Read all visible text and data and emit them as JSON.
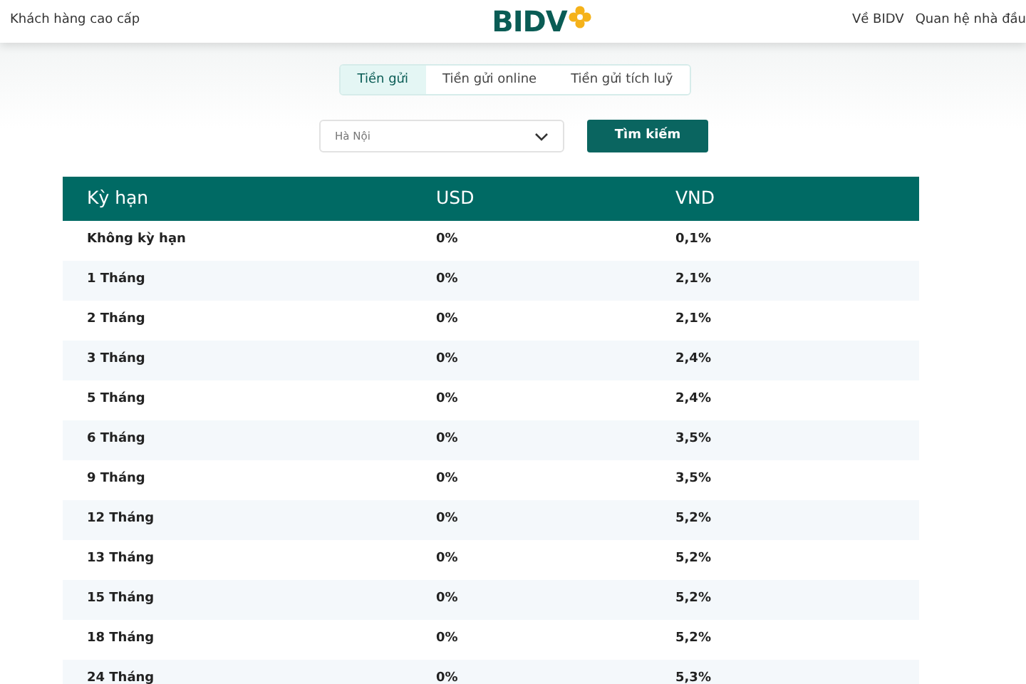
{
  "header": {
    "left_link": "Khách hàng cao cấp",
    "logo": "BIDV",
    "right_links": [
      "Về BIDV",
      "Quan hệ nhà đầu"
    ]
  },
  "tabs": [
    {
      "label": "Tiền gửi",
      "selected": true
    },
    {
      "label": "Tiền gửi online",
      "selected": false
    },
    {
      "label": "Tiền gửi tích luỹ",
      "selected": false
    }
  ],
  "filter": {
    "region": "Hà Nội",
    "button": "Tìm kiếm"
  },
  "table": {
    "columns": [
      "Kỳ hạn",
      "USD",
      "VND"
    ],
    "rows": [
      [
        "Không kỳ hạn",
        "0%",
        "0,1%"
      ],
      [
        "1 Tháng",
        "0%",
        "2,1%"
      ],
      [
        "2 Tháng",
        "0%",
        "2,1%"
      ],
      [
        "3 Tháng",
        "0%",
        "2,4%"
      ],
      [
        "5 Tháng",
        "0%",
        "2,4%"
      ],
      [
        "6 Tháng",
        "0%",
        "3,5%"
      ],
      [
        "9 Tháng",
        "0%",
        "3,5%"
      ],
      [
        "12 Tháng",
        "0%",
        "5,2%"
      ],
      [
        "13 Tháng",
        "0%",
        "5,2%"
      ],
      [
        "15 Tháng",
        "0%",
        "5,2%"
      ],
      [
        "18 Tháng",
        "0%",
        "5,2%"
      ],
      [
        "24 Tháng",
        "0%",
        "5,3%"
      ]
    ]
  }
}
